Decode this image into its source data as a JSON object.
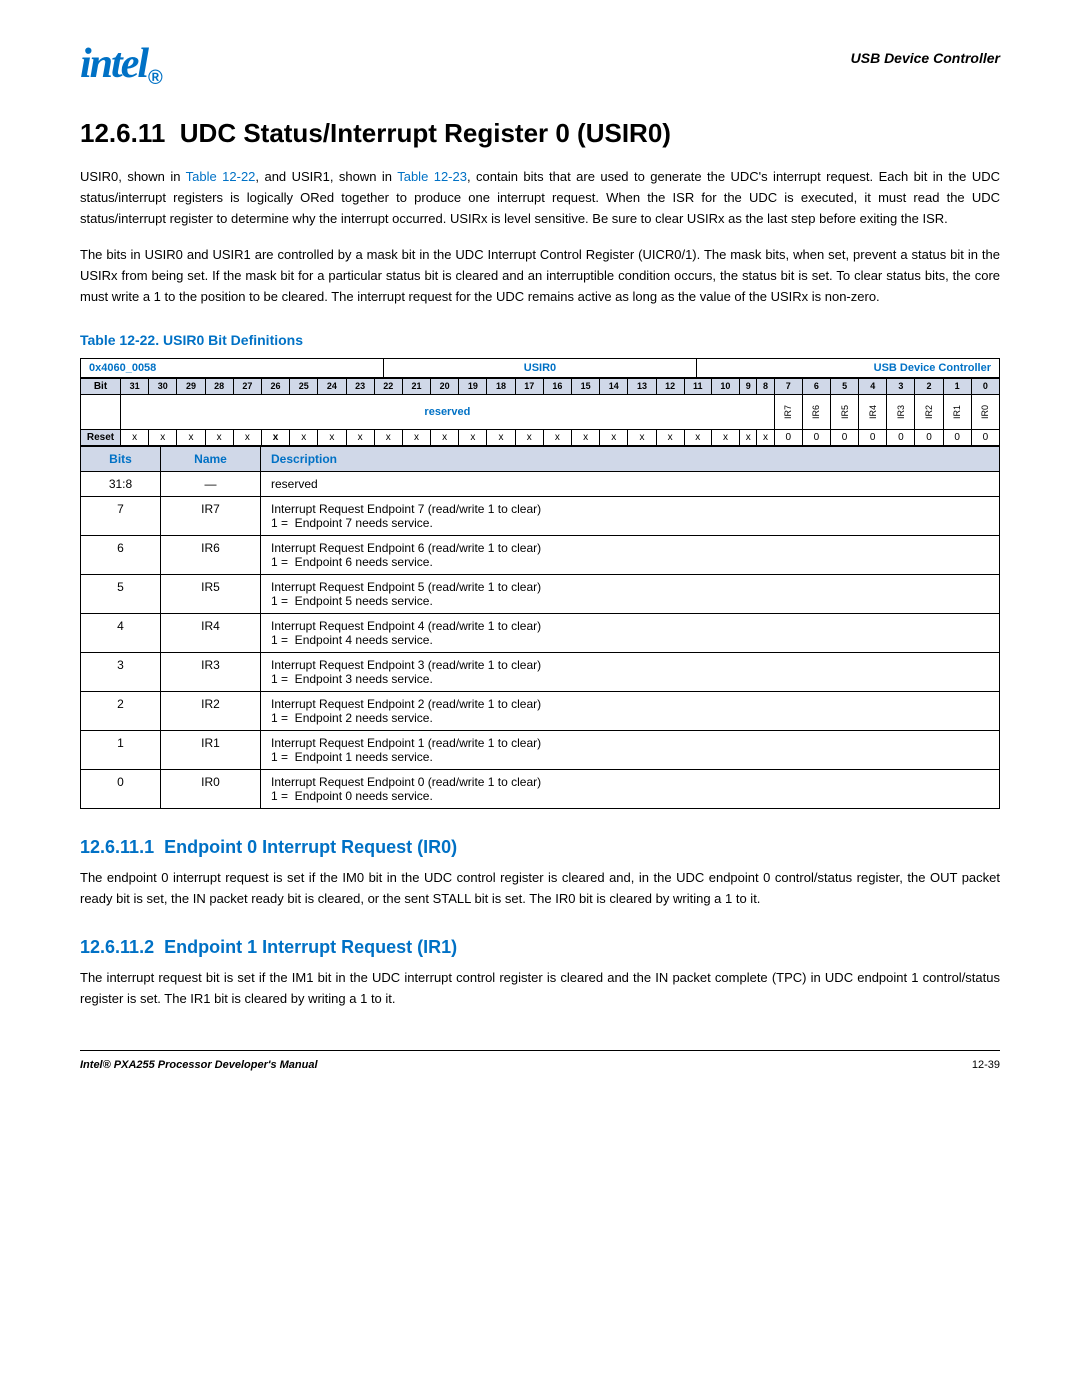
{
  "header": {
    "logo": "intₑl",
    "logo_text": "intel",
    "logo_dot": "®",
    "right_text": "USB Device Controller"
  },
  "section": {
    "number": "12.6.11",
    "title": "UDC Status/Interrupt Register 0 (USIR0)",
    "body1": "USIR0, shown in Table 12-22, and USIR1, shown in Table 12-23, contain bits that are used to generate the UDC's interrupt request. Each bit in the UDC status/interrupt registers is logically ORed together to produce one interrupt request. When the ISR for the UDC is executed, it must read the UDC status/interrupt register to determine why the interrupt occurred. USIRx is level sensitive. Be sure to clear USIRx as the last step before exiting the ISR.",
    "body2": "The bits in USIR0 and USIR1 are controlled by a mask bit in the UDC Interrupt Control Register (UICR0/1). The mask bits, when set, prevent a status bit in the USIRx from being set. If the mask bit for a particular status bit is cleared and an interruptible condition occurs, the status bit is set. To clear status bits, the core must write a 1 to the position to be cleared. The interrupt request for the UDC remains active as long as the value of the USIRx is non-zero.",
    "table_title": "Table 12-22. USIR0 Bit Definitions",
    "table_addr": "0x4060_0058",
    "table_reg": "USIR0",
    "table_udc": "USB Device Controller"
  },
  "bit_numbers": [
    "31",
    "30",
    "29",
    "28",
    "27",
    "26",
    "25",
    "24",
    "23",
    "22",
    "21",
    "20",
    "19",
    "18",
    "17",
    "16",
    "15",
    "14",
    "13",
    "12",
    "11",
    "10",
    "9",
    "8",
    "7",
    "6",
    "5",
    "4",
    "3",
    "2",
    "1",
    "0"
  ],
  "reserved_cols": 24,
  "ir_cols": [
    "IR7",
    "IR6",
    "IR5",
    "IR4",
    "IR3",
    "IR2",
    "IR1",
    "IR0"
  ],
  "reset_x_count": 24,
  "reset_0_count": 8,
  "bit_definitions": [
    {
      "bits": "31:8",
      "name": "—",
      "description": "reserved"
    },
    {
      "bits": "7",
      "name": "IR7",
      "description": "Interrupt Request Endpoint 7 (read/write 1 to clear)\n1 =  Endpoint 7 needs service."
    },
    {
      "bits": "6",
      "name": "IR6",
      "description": "Interrupt Request Endpoint 6 (read/write 1 to clear)\n1 =  Endpoint 6 needs service."
    },
    {
      "bits": "5",
      "name": "IR5",
      "description": "Interrupt Request Endpoint 5 (read/write 1 to clear)\n1 =  Endpoint 5 needs service."
    },
    {
      "bits": "4",
      "name": "IR4",
      "description": "Interrupt Request Endpoint 4 (read/write 1 to clear)\n1 =  Endpoint 4 needs service."
    },
    {
      "bits": "3",
      "name": "IR3",
      "description": "Interrupt Request Endpoint 3 (read/write 1 to clear)\n1 =  Endpoint 3 needs service."
    },
    {
      "bits": "2",
      "name": "IR2",
      "description": "Interrupt Request Endpoint 2 (read/write 1 to clear)\n1 =  Endpoint 2 needs service."
    },
    {
      "bits": "1",
      "name": "IR1",
      "description": "Interrupt Request Endpoint 1 (read/write 1 to clear)\n1 =  Endpoint 1 needs service."
    },
    {
      "bits": "0",
      "name": "IR0",
      "description": "Interrupt Request Endpoint 0 (read/write 1 to clear)\n1 =  Endpoint 0 needs service."
    }
  ],
  "subsections": [
    {
      "number": "12.6.11.1",
      "title": "Endpoint 0 Interrupt Request (IR0)",
      "body": "The endpoint 0 interrupt request is set if the IM0 bit in the UDC control register is cleared and, in the UDC endpoint 0 control/status register, the OUT packet ready bit is set, the IN packet ready bit is cleared, or the sent STALL bit is set. The IR0 bit is cleared by writing a 1 to it."
    },
    {
      "number": "12.6.11.2",
      "title": "Endpoint 1 Interrupt Request (IR1)",
      "body": "The interrupt request bit is set if the IM1 bit in the UDC interrupt control register is cleared and the IN packet complete (TPC) in UDC endpoint 1 control/status register is set. The IR1 bit is cleared by writing a 1 to it."
    }
  ],
  "footer": {
    "left": "Intel® PXA255 Processor Developer's Manual",
    "right": "12-39"
  },
  "colors": {
    "blue": "#0071c5",
    "header_bg": "#d0d8e8"
  }
}
